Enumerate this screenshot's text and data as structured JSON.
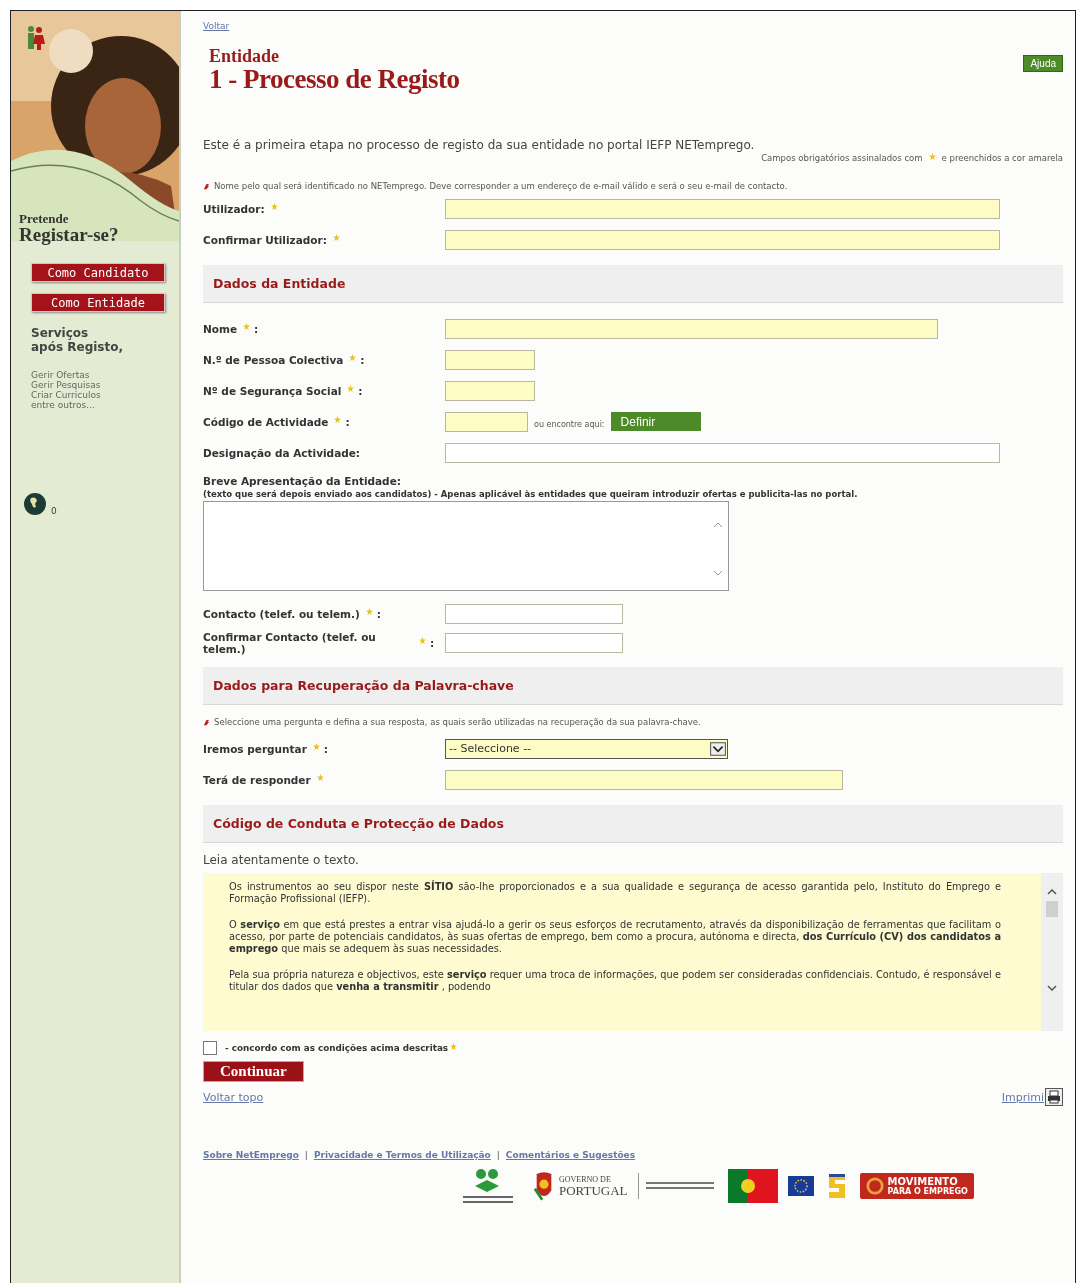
{
  "sidebar": {
    "question_small": "Pretende",
    "question_big": "Registar-se?",
    "buttons": [
      {
        "label": "Como Candidato"
      },
      {
        "label": "Como Entidade"
      }
    ],
    "services_title": [
      "Serviços",
      "após Registo,"
    ],
    "services": [
      "Gerir Ofertas",
      "Gerir Pesquisas",
      "Criar Curriculos",
      "entre outros..."
    ],
    "counter": "0"
  },
  "header": {
    "back_link": "Voltar",
    "help_button": "Ajuda",
    "subtitle": "Entidade",
    "title": "1 - Processo de Registo",
    "intro": "Este é a primeira etapa no processo de registo da sua entidade no portal IEFP NETemprego.",
    "required_note_before": "Campos obrigatórios assinalados com",
    "required_note_after": "e preenchidos a cor amarela"
  },
  "sections": [
    {
      "note": "Nome pelo qual será identificado no NETemprego. Deve corresponder a um endereço de e-mail válido e será o seu e-mail de contacto.",
      "fields": [
        {
          "kind": "long",
          "label": "Utilizador:",
          "required": true,
          "highlighted": true
        },
        {
          "kind": "long",
          "label": "Confirmar Utilizador:",
          "required": true,
          "highlighted": true
        }
      ]
    },
    {
      "title": "Dados da Entidade",
      "fields": [
        {
          "kind": "wide",
          "label": "Nome",
          "required": true,
          "suffix": ":",
          "highlighted": true
        },
        {
          "kind": "short",
          "label": "N.º de Pessoa Colectiva",
          "required": true,
          "suffix": ":",
          "highlighted": true
        },
        {
          "kind": "short",
          "label": "Nº de Segurança Social",
          "required": true,
          "suffix": ":",
          "highlighted": true
        },
        {
          "kind": "lookup",
          "label": "Código de Actividade",
          "required": true,
          "suffix": ":",
          "highlighted": true,
          "hint": "ou encontre aqui:",
          "button": "Definir"
        },
        {
          "kind": "long",
          "label": "Designação da Actividade:",
          "required": false,
          "highlighted": false
        },
        {
          "kind": "textarea",
          "label": "Breve Apresentação da Entidade:",
          "sublabel": "(texto que será depois enviado aos candidatos) - Apenas aplicável às entidades que queiram introduzir ofertas e publicita-las no portal."
        },
        {
          "kind": "medium",
          "label": "Contacto (telef. ou telem.)",
          "required": true,
          "suffix": ":",
          "highlighted": false
        },
        {
          "kind": "medium",
          "label": "Confirmar Contacto (telef. ou telem.)",
          "required": true,
          "suffix": ":",
          "highlighted": false
        }
      ]
    },
    {
      "title": "Dados para Recuperação da Palavra-chave",
      "note": "Seleccione uma pergunta e defina a sua resposta, as quais serão utilizadas na recuperação da sua palavra-chave.",
      "fields": [
        {
          "kind": "select",
          "label": "Iremos perguntar",
          "required": true,
          "suffix": ":",
          "highlighted": true,
          "value": "-- Seleccione --"
        },
        {
          "kind": "answer",
          "label": "Terá de responder",
          "required": true,
          "highlighted": true
        }
      ]
    },
    {
      "title": "Código de Conduta e Protecção de Dados"
    }
  ],
  "terms": {
    "instruction": "Leia atentamente o texto.",
    "paragraphs": [
      "Os instrumentos ao seu dispor neste **SÍTIO** são-lhe proporcionados e a sua qualidade e segurança de acesso garantida pelo, Instituto do Emprego e Formação Profissional (IEFP).",
      "O **serviço** em que está prestes a entrar visa ajudá-lo a gerir os seus esforços de recrutamento, através da disponibilização de ferramentas que facilitam o acesso, por parte de potenciais candidatos, às suas ofertas de emprego, bem como a procura, autónoma e directa, **dos Currículo (CV) dos candidatos a emprego** que mais se adequem às suas necessidades.",
      "Pela sua própria natureza e objectivos, este **serviço** requer uma troca de informações, que podem ser consideradas confidenciais. Contudo, é responsável e titular dos dados que **venha a transmitir** , podendo"
    ],
    "agree": {
      "label": "- concordo com as condições acima descritas",
      "checked": false,
      "required": true
    },
    "submit": "Continuar"
  },
  "bottom": {
    "top_link": "Voltar topo",
    "print_link": "Imprimi"
  },
  "footer": {
    "separator": "|",
    "links": [
      "Sobre NetEmprego",
      "Privacidade e Termos de Utilização",
      "Comentários e Sugestões"
    ],
    "logos": [
      {
        "kind": "iefp"
      },
      {
        "kind": "gov",
        "lines": [
          "GOVERNO DE",
          "PORTUGAL"
        ]
      },
      {
        "kind": "ministry"
      },
      {
        "kind": "flag"
      },
      {
        "kind": "eu"
      },
      {
        "kind": "fse"
      },
      {
        "kind": "movement",
        "lines": [
          "MOVIMENTO",
          "PARA O EMPREGO"
        ]
      }
    ]
  }
}
